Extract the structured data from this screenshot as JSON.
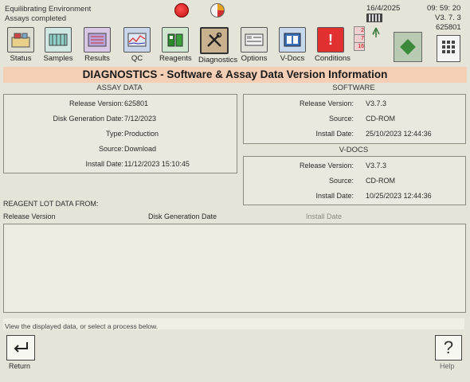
{
  "status": {
    "line1": "Equilibrating Environment",
    "line2": "Assays completed",
    "date": "16/4/2025",
    "time": "09: 59: 20",
    "version": "V3. 7. 3",
    "serial": "625801",
    "counters": [
      "2",
      "7",
      "16"
    ],
    "antenna_label": "A"
  },
  "toolbar": {
    "items": [
      {
        "id": "status",
        "label": "Status"
      },
      {
        "id": "samples",
        "label": "Samples"
      },
      {
        "id": "results",
        "label": "Results"
      },
      {
        "id": "qc",
        "label": "QC"
      },
      {
        "id": "reagents",
        "label": "Reagents"
      },
      {
        "id": "diagnostics",
        "label": "Diagnostics"
      },
      {
        "id": "options",
        "label": "Options"
      },
      {
        "id": "vdocs",
        "label": "V-Docs"
      },
      {
        "id": "conditions",
        "label": "Conditions"
      }
    ]
  },
  "page": {
    "title": "DIAGNOSTICS - Software & Assay Data Version Information"
  },
  "assay": {
    "title": "ASSAY DATA",
    "rows": [
      {
        "label": "Release Version:",
        "value": "625801"
      },
      {
        "label": "Disk Generation Date:",
        "value": "7/12/2023"
      },
      {
        "label": "Type:",
        "value": "Production"
      },
      {
        "label": "Source:",
        "value": "Download"
      },
      {
        "label": "Install Date:",
        "value": "11/12/2023  15:10:45"
      }
    ]
  },
  "software": {
    "title": "SOFTWARE",
    "rows": [
      {
        "label": "Release Version:",
        "value": "V3.7.3"
      },
      {
        "label": "Source:",
        "value": "CD-ROM"
      },
      {
        "label": "Install Date:",
        "value": "25/10/2023  12:44:36"
      }
    ]
  },
  "vdocs": {
    "title": "V-DOCS",
    "rows": [
      {
        "label": "Release Version:",
        "value": "V3.7.3"
      },
      {
        "label": "Source:",
        "value": "CD-ROM"
      },
      {
        "label": "Install Date:",
        "value": "10/25/2023  12:44:36"
      }
    ]
  },
  "reagent": {
    "title": "REAGENT LOT DATA FROM:",
    "columns": [
      "Release Version",
      "Disk Generation Date",
      "Install Date"
    ]
  },
  "hint": "View the displayed data, or select a process below.",
  "bottom": {
    "return_label": "Return",
    "help_label": "Help"
  },
  "colors": {
    "title_bar": "#f4cfb5",
    "indicator_red": "#d82020",
    "conditions_red": "#e03030"
  }
}
